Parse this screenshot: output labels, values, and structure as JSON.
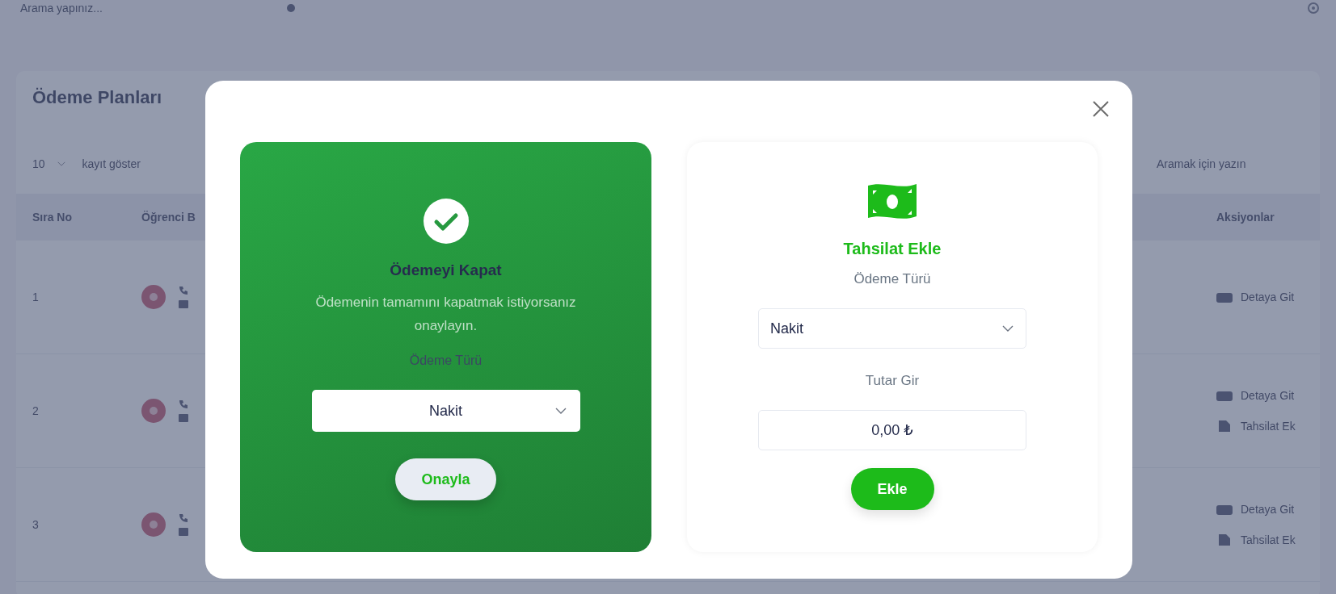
{
  "background": {
    "search": {
      "placeholder": "Arama yapınız..."
    },
    "title": "Ödeme Planları",
    "page_size": "10",
    "page_size_label": "kayıt göster",
    "table_search": {
      "placeholder": "Aramak için yazın"
    },
    "columns": [
      "Sıra No",
      "Öğrenci B",
      "Aksiyonlar"
    ],
    "rows": [
      {
        "number": "1",
        "actions": [
          "Detaya Git"
        ]
      },
      {
        "number": "2",
        "actions": [
          "Detaya Git",
          "Tahsilat Ek"
        ]
      },
      {
        "number": "3",
        "actions": [
          "Detaya Git",
          "Tahsilat Ek"
        ]
      }
    ]
  },
  "modal": {
    "close_payment": {
      "title": "Ödemeyi Kapat",
      "description": "Ödemenin tamamını kapatmak istiyorsanız onaylayın.",
      "field_label": "Ödeme Türü",
      "select": "Nakit",
      "button": "Onayla"
    },
    "add_collection": {
      "title": "Tahsilat Ekle",
      "field_label": "Ödeme Türü",
      "select": "Nakit",
      "amount_label": "Tutar Gir",
      "amount": "0,00 ₺",
      "button": "Ekle"
    }
  }
}
